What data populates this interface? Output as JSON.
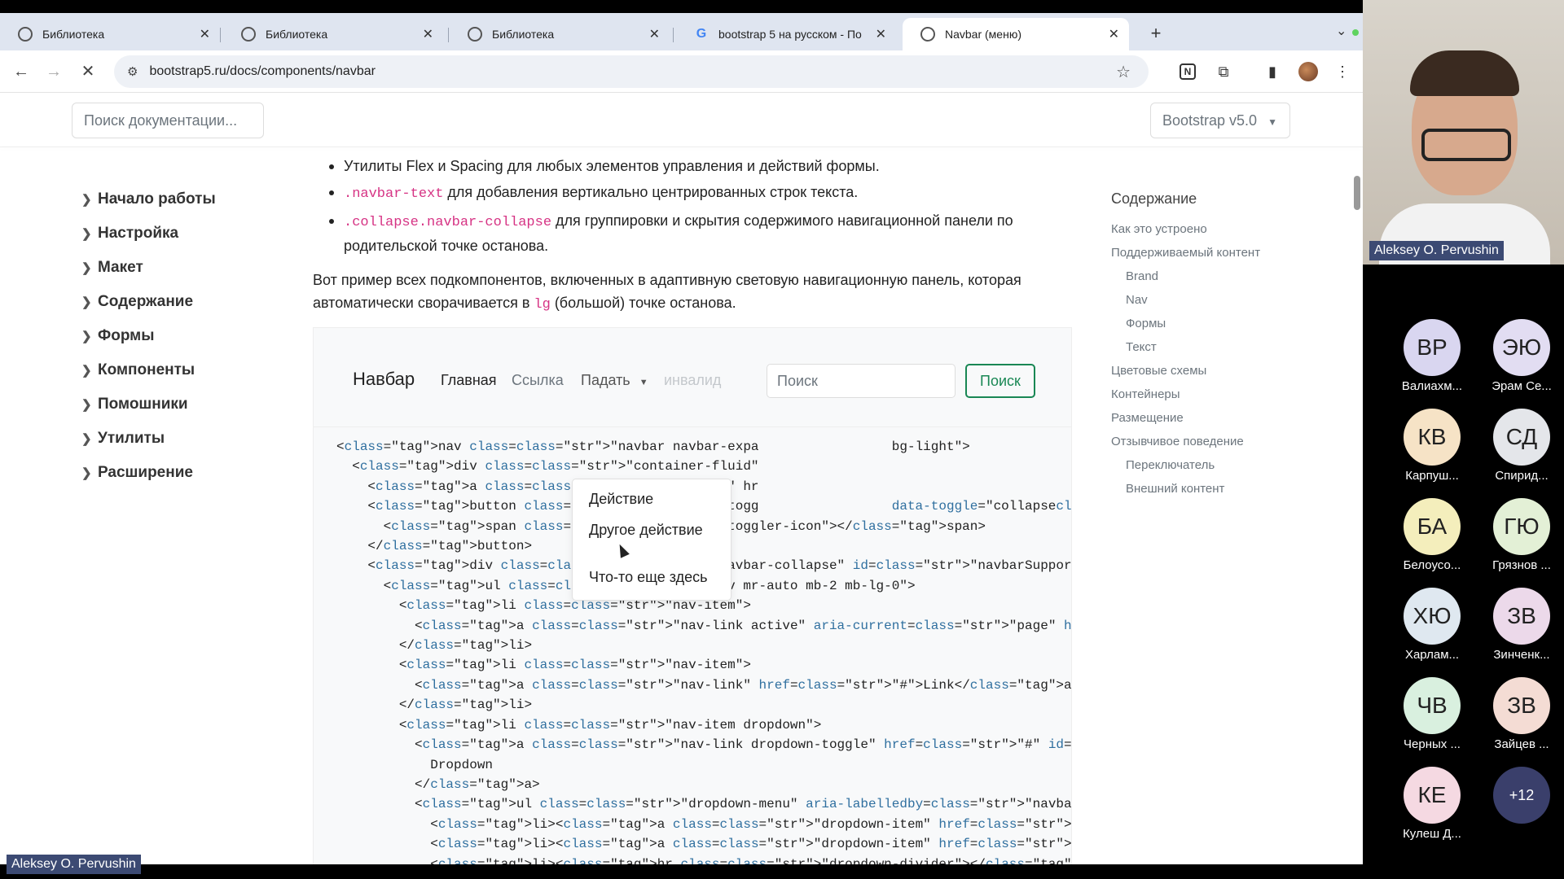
{
  "tabs": [
    {
      "title": "Библиотека",
      "icon": "globe-icon"
    },
    {
      "title": "Библиотека",
      "icon": "globe-icon"
    },
    {
      "title": "Библиотека",
      "icon": "globe-icon"
    },
    {
      "title": "bootstrap 5 на русском - По",
      "icon": "google-icon"
    },
    {
      "title": "Navbar (меню)",
      "icon": "bootstrap-icon"
    }
  ],
  "address_bar": {
    "url": "bootstrap5.ru/docs/components/navbar"
  },
  "docs_header": {
    "search_placeholder": "Поиск документации...",
    "version": "Bootstrap v5.0"
  },
  "sidebar": {
    "items": [
      "Начало работы",
      "Настройка",
      "Макет",
      "Содержание",
      "Формы",
      "Компоненты",
      "Помошники",
      "Утилиты",
      "Расширение"
    ]
  },
  "content": {
    "bullet1": "Утилиты Flex и Spacing для любых элементов управления и действий формы.",
    "bullet2_code": ".navbar-text",
    "bullet2_text": " для добавления вертикально центрированных строк текста.",
    "bullet3_code": ".collapse.navbar-collapse",
    "bullet3_text": " для группировки и скрытия содержимого навигационной панели по родительской точке останова.",
    "para_before": "Вот пример всех подкомпонентов, включенных в адаптивную световую навигационную панель, которая автоматически сворачивается в ",
    "para_code": "lg",
    "para_after": " (большой) точке останова."
  },
  "example_navbar": {
    "brand": "Навбар",
    "link_home": "Главная",
    "link": "Ссылка",
    "dropdown": "Падать",
    "disabled": "инвалид",
    "search_placeholder": "Поиск",
    "search_button": "Поиск",
    "dropdown_items": [
      "Действие",
      "Другое действие",
      "Что-то еще здесь"
    ]
  },
  "code_lines": [
    "<nav class=\"navbar navbar-expa                 bg-light\">",
    "  <div class=\"container-fluid\"",
    "    <a class=\"navbar-brand\" hr",
    "    <button class=\"navbar-togg                 data-toggle=\"collapse\" data-target=\"#navb",
    "      <span class=\"navbar-toggler-icon\"></span>",
    "    </button>",
    "    <div class=\"collapse navbar-collapse\" id=\"navbarSupportedContent\">",
    "      <ul class=\"navbar-nav mr-auto mb-2 mb-lg-0\">",
    "        <li class=\"nav-item\">",
    "          <a class=\"nav-link active\" aria-current=\"page\" href=\"#\">Home</a>",
    "        </li>",
    "        <li class=\"nav-item\">",
    "          <a class=\"nav-link\" href=\"#\">Link</a>",
    "        </li>",
    "        <li class=\"nav-item dropdown\">",
    "          <a class=\"nav-link dropdown-toggle\" href=\"#\" id=\"navbarDropdown\" role=\"button\" c",
    "            Dropdown",
    "          </a>",
    "          <ul class=\"dropdown-menu\" aria-labelledby=\"navbarDropdown\">",
    "            <li><a class=\"dropdown-item\" href=\"#\">Action</a></li>",
    "            <li><a class=\"dropdown-item\" href=\"#\">Another action</a></li>",
    "            <li><hr class=\"dropdown-divider\"></li>"
  ],
  "toc": {
    "title": "Содержание",
    "items": [
      {
        "label": "Как это устроено",
        "sub": false
      },
      {
        "label": "Поддерживаемый контент",
        "sub": false
      },
      {
        "label": "Brand",
        "sub": true
      },
      {
        "label": "Nav",
        "sub": true
      },
      {
        "label": "Формы",
        "sub": true
      },
      {
        "label": "Текст",
        "sub": true
      },
      {
        "label": "Цветовые схемы",
        "sub": false
      },
      {
        "label": "Контейнеры",
        "sub": false
      },
      {
        "label": "Размещение",
        "sub": false
      },
      {
        "label": "Отзывчивое поведение",
        "sub": false
      },
      {
        "label": "Переключатель",
        "sub": true
      },
      {
        "label": "Внешний контент",
        "sub": true
      }
    ]
  },
  "call": {
    "speaker_name": "Aleksey O. Pervushin",
    "self_name": "Aleksey O. Pervushin",
    "participants": [
      {
        "initials": "ВР",
        "name": "Валиахм...",
        "color": "#d9d6f0"
      },
      {
        "initials": "ЭЮ",
        "name": "Эрам Се...",
        "color": "#e2ddf2"
      },
      {
        "initials": "КВ",
        "name": "Карпуш...",
        "color": "#f6e3c6"
      },
      {
        "initials": "СД",
        "name": "Спирид...",
        "color": "#e4e6ea"
      },
      {
        "initials": "БА",
        "name": "Белоусо...",
        "color": "#f4eebc"
      },
      {
        "initials": "ГЮ",
        "name": "Грязнов ...",
        "color": "#e3f0d6"
      },
      {
        "initials": "ХЮ",
        "name": "Харлам...",
        "color": "#dfe8f0"
      },
      {
        "initials": "ЗВ",
        "name": "Зинченк...",
        "color": "#ecd9ea"
      },
      {
        "initials": "ЧВ",
        "name": "Черных ...",
        "color": "#d9f0df"
      },
      {
        "initials": "ЗВ",
        "name": "Зайцев ...",
        "color": "#f4dcd4"
      },
      {
        "initials": "КЕ",
        "name": "Кулеш Д...",
        "color": "#f5d9e2"
      },
      {
        "initials": "+12",
        "name": "",
        "color": "#3a3f6b"
      }
    ]
  },
  "colors": {
    "accent_green": "#198754",
    "code_pink": "#d63384",
    "call_label_bg": "#3c4a73"
  }
}
